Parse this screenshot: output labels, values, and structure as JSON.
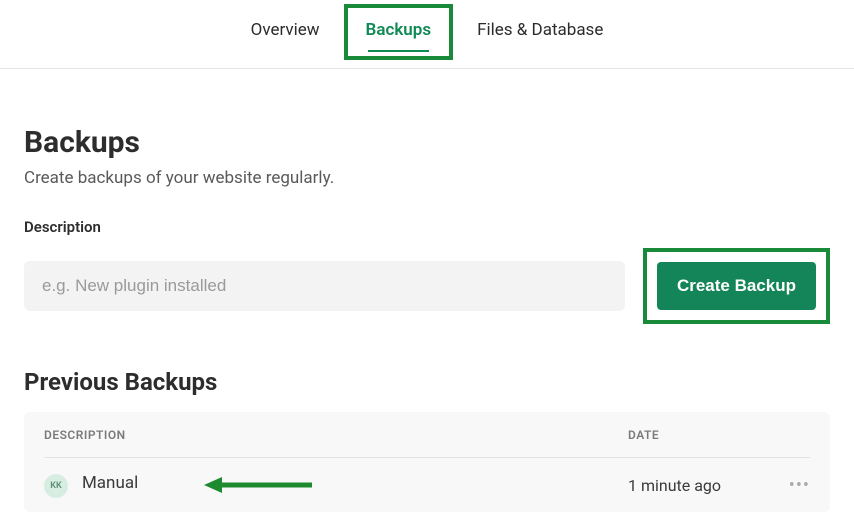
{
  "tabs": [
    {
      "label": "Overview",
      "active": false
    },
    {
      "label": "Backups",
      "active": true
    },
    {
      "label": "Files & Database",
      "active": false
    }
  ],
  "page": {
    "title": "Backups",
    "subtitle": "Create backups of your website regularly."
  },
  "form": {
    "label": "Description",
    "placeholder": "e.g. New plugin installed",
    "value": "",
    "button": "Create Backup"
  },
  "previous": {
    "title": "Previous Backups",
    "columns": {
      "description": "DESCRIPTION",
      "date": "DATE"
    },
    "rows": [
      {
        "avatar": "KK",
        "description": "Manual",
        "date": "1 minute ago"
      }
    ]
  },
  "icons": {
    "more": "•••"
  }
}
